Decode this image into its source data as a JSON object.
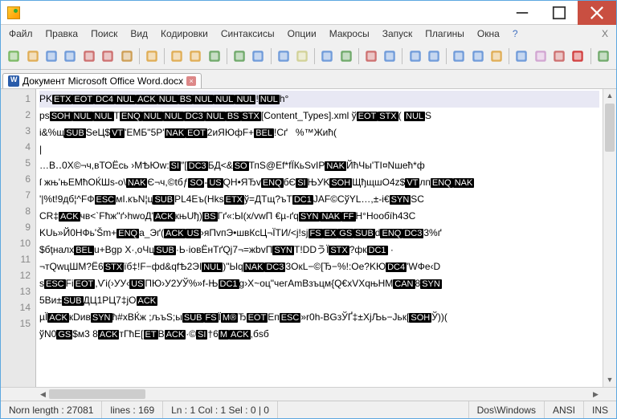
{
  "menus": [
    "Файл",
    "Правка",
    "Поиск",
    "Вид",
    "Кодировки",
    "Синтаксисы",
    "Опции",
    "Макросы",
    "Запуск",
    "Плагины",
    "Окна",
    "?",
    "X"
  ],
  "tab": {
    "label": "Документ Microsoft Office Word.docx"
  },
  "toolbar_icons": [
    "new-icon",
    "open-icon",
    "save-icon",
    "saveall-icon",
    "close-icon",
    "closeall-icon",
    "print-icon",
    "cut-icon",
    "copy-icon",
    "paste-icon",
    "undo-icon",
    "redo-icon",
    "find-icon",
    "replace-icon",
    "binoculars-icon",
    "bookmark-icon",
    "zoom-in-icon",
    "zoom-out-icon",
    "sync-icon",
    "viewsplit-icon",
    "fold-icon",
    "outdent-icon",
    "indent-icon",
    "wrap-icon",
    "doc-icon",
    "funcs-icon",
    "docmap-icon",
    "record-icon",
    "play-icon"
  ],
  "icon_colors": [
    "#69b04e",
    "#dda23c",
    "#5b8dd6",
    "#5b8dd6",
    "#c85b5b",
    "#c85b5b",
    "#c8903c",
    "#dda23c",
    "#dda23c",
    "#dda23c",
    "#5b9d55",
    "#5b9d55",
    "#5b8dd6",
    "#5b8dd6",
    "#cc8",
    "#5b8dd6",
    "#5b9d55",
    "#c85b5b",
    "#5b8dd6",
    "#5b8dd6",
    "#5b8dd6",
    "#5b8dd6",
    "#5b8dd6",
    "#dda23c",
    "#5b8dd6",
    "#c9c",
    "#c85b5b",
    "#c22",
    "#5b9d55"
  ],
  "separators_after": [
    6,
    7,
    10,
    12,
    14,
    16,
    18,
    20,
    23,
    27
  ],
  "gutter": [
    "1",
    "2",
    "3",
    "4",
    "5",
    "6",
    "7",
    "8",
    "9",
    "10",
    "11",
    "12",
    "13",
    "14",
    "15"
  ],
  "lines": [
    [
      [
        "PK",
        0
      ],
      [
        "ETX",
        1
      ],
      [
        "EOT",
        1
      ],
      [
        "DC4",
        1
      ],
      [
        "NUL",
        1
      ],
      [
        "ACK",
        1
      ],
      [
        "NUL",
        1
      ],
      [
        "BS",
        1
      ],
      [
        "NUL",
        1
      ],
      [
        "NUL",
        1
      ],
      [
        "NUL",
        1
      ],
      [
        "!",
        0
      ],
      [
        "NUL",
        1
      ],
      [
        "h°",
        0
      ]
    ],
    [
      [
        "ps",
        0
      ],
      [
        "SOH",
        1
      ],
      [
        "NUL",
        1
      ],
      [
        "NUL",
        1
      ],
      [
        "T",
        0
      ],
      [
        "ENQ",
        1
      ],
      [
        "NUL",
        1
      ],
      [
        "NUL",
        1
      ],
      [
        "DC3",
        1
      ],
      [
        "NUL",
        1
      ],
      [
        "BS",
        1
      ],
      [
        "STX",
        1
      ],
      [
        "[Content_Types].xml ў",
        0
      ],
      [
        "EOT",
        1
      ],
      [
        "STX",
        1
      ],
      [
        "( ",
        0
      ],
      [
        "NUL",
        1
      ],
      [
        "S",
        0
      ]
    ],
    [
      [
        "і&%щ",
        0
      ],
      [
        "SUB",
        1
      ],
      [
        "SeЦ$",
        0
      ],
      [
        "VT",
        1
      ],
      [
        "'ЕМБ\"5P'",
        0
      ],
      [
        "NAK",
        1
      ],
      [
        "EOT",
        1
      ],
      [
        "2иЯЮфF+",
        0
      ],
      [
        "BEL",
        1
      ],
      [
        "!Cґ   %™Жић(",
        0
      ]
    ],
    [
      [
        "|",
        0
      ]
    ],
    [
      [
        "…B‥0X©¬ч,вТОЁсь ›МѢЮw:",
        0
      ],
      [
        "SI",
        1
      ],
      [
        "″[",
        0
      ],
      [
        "DC3",
        1
      ],
      [
        "БД<&",
        0
      ],
      [
        "SO",
        1
      ],
      [
        "ТпS@Ef*fЇКьSvIP",
        0
      ],
      [
        "NAK",
        1
      ],
      [
        "ЙћЧы'TI¤Nшећ*ф",
        0
      ]
    ],
    [
      [
        "ſ жњ'њЕМћОЌШs-o\\",
        0
      ],
      [
        "NAK",
        1
      ],
      [
        "Є¬ч,©tбƒ",
        0
      ],
      [
        "SO",
        1
      ],
      [
        "-",
        0
      ],
      [
        "US",
        1
      ],
      [
        "QH•ЯЂv",
        0
      ],
      [
        "ENQ",
        1
      ],
      [
        "бЄ",
        0
      ],
      [
        "SI",
        1
      ],
      [
        "ЊУK",
        0
      ],
      [
        "SOH",
        1
      ],
      [
        "ЩђщшO4z$",
        0
      ],
      [
        "VT",
        1
      ],
      [
        "лп",
        0
      ],
      [
        "ENQ",
        1
      ],
      [
        "NAK",
        1
      ]
    ],
    [
      [
        "'|%t!9дб¦^FФ",
        0
      ],
      [
        "ESC",
        1
      ],
      [
        "мI.къN¦ц",
        0
      ],
      [
        "SUB",
        1
      ],
      [
        "PL4Еъ(Hks",
        0
      ],
      [
        "ETX",
        1
      ],
      [
        "ў=ДTщ?ъТ",
        0
      ],
      [
        "DC1",
        1
      ],
      [
        "JAF©CўYL…,±-і€",
        0
      ],
      [
        "SYN",
        1
      ],
      [
        "SC",
        0
      ]
    ],
    [
      [
        "CR‡",
        0
      ],
      [
        "ACK",
        1
      ],
      [
        "чв<`Fћж\"ґ›hwoД'",
        0
      ],
      [
        "ACK",
        1
      ],
      [
        "књUђ)",
        0
      ],
      [
        "BS",
        1
      ],
      [
        "Гґ«:Ы(x/vwП €µ-ґq",
        0
      ],
      [
        "SYN",
        1
      ],
      [
        "NAK",
        1
      ],
      [
        "FF",
        1
      ],
      [
        "H°Hooбїh4ЗС",
        0
      ]
    ],
    [
      [
        "KUь»Й0HФь'Šm+",
        0
      ],
      [
        "ENQ",
        1
      ],
      [
        "a_Эґ(",
        0
      ],
      [
        "ACK",
        1
      ],
      [
        "US",
        1
      ],
      [
        "›яПvпЭ•швКсЦ¬ЇТИ/<j!sj",
        0
      ],
      [
        "FS",
        1
      ],
      [
        "EX",
        1
      ],
      [
        "GS",
        1
      ],
      [
        "SUB",
        1
      ],
      [
        "d",
        0
      ],
      [
        "ENQ",
        1
      ],
      [
        "DC3",
        1
      ],
      [
        "3%ґ",
        0
      ]
    ],
    [
      [
        "$бţнaлx",
        0
      ],
      [
        "BEL",
        1
      ],
      [
        "u+Bgp X·,oЧц",
        0
      ],
      [
        "SUB",
        1
      ],
      [
        "·Ь·ioвЁнТґQj7¬=жbvП",
        0
      ],
      [
        "SYN",
        1
      ],
      [
        "Т!DDうЇ",
        0
      ],
      [
        "STX",
        1
      ],
      [
        "?фк",
        0
      ],
      [
        "DC1",
        1
      ],
      [
        " ·",
        0
      ]
    ],
    [
      [
        "¬тQwцШМ?Ё6",
        0
      ],
      [
        "STX",
        1
      ],
      [
        "ïб‡!F−фd&qfѢ2ЭІ",
        0
      ],
      [
        "NUL",
        1
      ],
      [
        ")\"Ыq",
        0
      ],
      [
        "NAK",
        1
      ],
      [
        "DC3",
        1
      ],
      [
        "3OкL−©[Ђ−%!:Oe?KЮ",
        0
      ],
      [
        "DC4",
        1
      ],
      [
        "'WФe‹",
        0
      ],
      [
        "D",
        0
      ]
    ],
    [
      [
        "s",
        0
      ],
      [
        "ESC",
        1
      ],
      [
        "Fі",
        0
      ],
      [
        "EOT",
        1
      ],
      [
        ",Ѵі(›УУ‹",
        0
      ],
      [
        "US",
        1
      ],
      [
        "ПЮ›У2УЎ%»f-Њ",
        0
      ],
      [
        "DC1",
        1
      ],
      [
        "g›X~оц\"чегAmBзъцм{Q€xVXqњНМ",
        0
      ],
      [
        "CAN",
        1
      ],
      [
        "8",
        0
      ],
      [
        "SYN",
        1
      ]
    ],
    [
      [
        "5Ви±",
        0
      ],
      [
        "SUB",
        1
      ],
      [
        "ДЦ1РЦ7‡jO",
        0
      ],
      [
        "ACK",
        1
      ]
    ],
    [
      [
        "µЇ",
        0
      ],
      [
        "ACK",
        1
      ],
      [
        "кDив",
        0
      ],
      [
        "SYN",
        1
      ],
      [
        "ћ#хВЌж ;љъЅ;ы",
        0
      ],
      [
        "SUB",
        1
      ],
      [
        "FS",
        1
      ],
      [
        "Ї",
        0
      ],
      [
        "M®",
        1
      ],
      [
        "Ђ",
        0
      ],
      [
        "EOT",
        1
      ],
      [
        "Eп",
        0
      ],
      [
        "ESC",
        1
      ],
      [
        "»r0h-BGзЎҐ‡±ХjЉь−Јьк[",
        0
      ],
      [
        "SOH",
        1
      ],
      [
        "Ў))(",
        0
      ]
    ],
    [
      [
        "ўN0",
        0
      ],
      [
        "GS",
        1
      ],
      [
        "$м3 8",
        0
      ],
      [
        "ACK",
        1
      ],
      [
        "тГћЕ[",
        0
      ],
      [
        "ET",
        1
      ],
      [
        "B",
        0
      ],
      [
        "ACK",
        1
      ],
      [
        "·©",
        0
      ],
      [
        "SI",
        1
      ],
      [
        "†6",
        0
      ],
      [
        "M",
        1
      ],
      [
        "ACK",
        1
      ],
      [
        ",бsб",
        0
      ]
    ]
  ],
  "status": {
    "norn": "Norn length : 27081",
    "lines": "lines : 169",
    "pos": "Ln : 1   Col : 1   Sel : 0 | 0",
    "eol": "Dos\\Windows",
    "enc": "ANSI",
    "mode": "INS"
  }
}
